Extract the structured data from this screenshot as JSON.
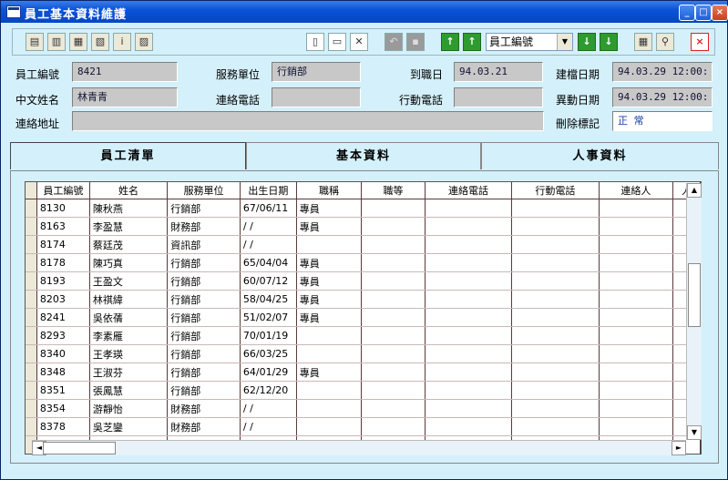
{
  "window": {
    "title": "員工基本資料維護",
    "minimize_glyph": "_",
    "maximize_glyph": "□",
    "close_glyph": "×"
  },
  "toolbar": {
    "sort_select_value": "員工編號",
    "dropdown_glyph": "▼",
    "up_glyph": "↑",
    "down_glyph": "↓",
    "close_glyph": "×"
  },
  "form": {
    "emp_no_label": "員工編號",
    "emp_no_value": "8421",
    "dept_label": "服務單位",
    "dept_value": "行銷部",
    "hire_date_label": "到職日",
    "hire_date_value": "94.03.21",
    "created_label": "建檔日期",
    "created_value": "94.03.29 12:00:",
    "cn_name_label": "中文姓名",
    "cn_name_value": "林青青",
    "phone_label": "連絡電話",
    "phone_value": "",
    "mobile_label": "行動電話",
    "mobile_value": "",
    "modified_label": "異動日期",
    "modified_value": "94.03.29 12:00:",
    "address_label": "連絡地址",
    "address_value": "",
    "delete_flag_label": "刪除標記",
    "delete_flag_value": "正  常"
  },
  "tabs": [
    "員工清單",
    "基本資料",
    "人事資料"
  ],
  "grid": {
    "columns": [
      "員工編號",
      "姓名",
      "服務單位",
      "出生日期",
      "職稱",
      "職等",
      "連絡電話",
      "行動電話",
      "連絡人",
      "人"
    ],
    "rows": [
      [
        "8130",
        "陳秋燕",
        "行銷部",
        "67/06/11",
        "專員"
      ],
      [
        "8163",
        "李盈慧",
        "財務部",
        "/  /",
        "專員"
      ],
      [
        "8174",
        "蔡廷茂",
        "資訊部",
        "/  /",
        ""
      ],
      [
        "8178",
        "陳巧真",
        "行銷部",
        "65/04/04",
        "專員"
      ],
      [
        "8193",
        "王盈文",
        "行銷部",
        "60/07/12",
        "專員"
      ],
      [
        "8203",
        "林祺緯",
        "行銷部",
        "58/04/25",
        "專員"
      ],
      [
        "8241",
        "吳依蒨",
        "行銷部",
        "51/02/07",
        "專員"
      ],
      [
        "8293",
        "李素雁",
        "行銷部",
        "70/01/19",
        ""
      ],
      [
        "8340",
        "王孝瑛",
        "行銷部",
        "66/03/25",
        ""
      ],
      [
        "8348",
        "王淑芬",
        "行銷部",
        "64/01/29",
        "專員"
      ],
      [
        "8351",
        "張鳳慧",
        "行銷部",
        "62/12/20",
        ""
      ],
      [
        "8354",
        "游靜怡",
        "財務部",
        "/  /",
        ""
      ],
      [
        "8378",
        "吳芝鑾",
        "財務部",
        "/  /",
        ""
      ],
      [
        "8390",
        "楊靜如",
        "行銷部",
        "/  /",
        ""
      ]
    ],
    "scroll_up_glyph": "▲",
    "scroll_down_glyph": "▼",
    "scroll_left_glyph": "◄",
    "scroll_right_glyph": "►"
  }
}
